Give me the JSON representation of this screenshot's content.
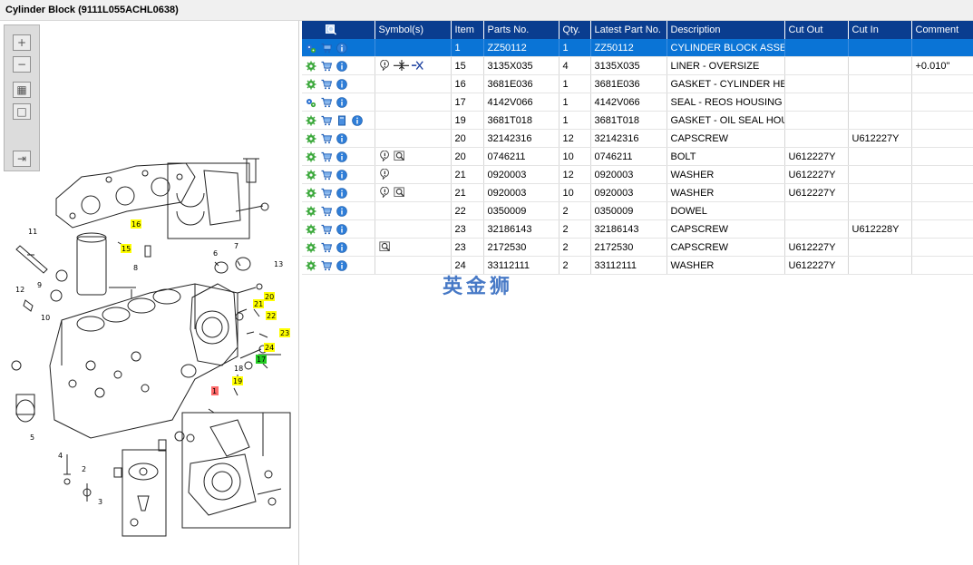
{
  "window": {
    "title": "Cylinder Block (9111L055ACHL0638)"
  },
  "toolbar": {
    "buttons": [
      {
        "icon": "zoom-in-icon"
      },
      {
        "icon": "zoom-out-icon"
      },
      {
        "icon": "fit-view-icon"
      },
      {
        "icon": "actual-size-icon"
      },
      {
        "icon": "export-icon"
      }
    ]
  },
  "diagram": {
    "callouts_plain": [
      "11",
      "8",
      "6",
      "7",
      "13",
      "12",
      "9",
      "10",
      "18",
      "5",
      "4",
      "3",
      "2"
    ],
    "callouts_yellow": [
      "16",
      "15",
      "20",
      "21",
      "22",
      "23",
      "24",
      "19"
    ],
    "callouts_green": [
      "17"
    ],
    "callouts_red": [
      "1"
    ]
  },
  "grid": {
    "headers": {
      "symbols": "Symbol(s)",
      "item": "Item",
      "parts_no": "Parts No.",
      "qty": "Qty.",
      "latest": "Latest Part No.",
      "description": "Description",
      "cut_out": "Cut Out",
      "cut_in": "Cut In",
      "comment": "Comment"
    },
    "rows": [
      {
        "item": "1",
        "parts_no": "ZZ50112",
        "qty": "1",
        "latest": "ZZ50112",
        "description": "CYLINDER BLOCK ASSEMBLY",
        "cut_out": "",
        "cut_in": "",
        "comment": ""
      },
      {
        "item": "15",
        "parts_no": "3135X035",
        "qty": "4",
        "latest": "3135X035",
        "description": "LINER - OVERSIZE",
        "cut_out": "",
        "cut_in": "",
        "comment": "+0.010\""
      },
      {
        "item": "16",
        "parts_no": "3681E036",
        "qty": "1",
        "latest": "3681E036",
        "description": "GASKET - CYLINDER HEAD",
        "cut_out": "",
        "cut_in": "",
        "comment": ""
      },
      {
        "item": "17",
        "parts_no": "4142V066",
        "qty": "1",
        "latest": "4142V066",
        "description": "SEAL - REOS HOUSING",
        "cut_out": "",
        "cut_in": "",
        "comment": ""
      },
      {
        "item": "19",
        "parts_no": "3681T018",
        "qty": "1",
        "latest": "3681T018",
        "description": "GASKET - OIL SEAL HOUSING",
        "cut_out": "",
        "cut_in": "",
        "comment": ""
      },
      {
        "item": "20",
        "parts_no": "32142316",
        "qty": "12",
        "latest": "32142316",
        "description": "CAPSCREW",
        "cut_out": "",
        "cut_in": "U612227Y",
        "comment": ""
      },
      {
        "item": "20",
        "parts_no": "0746211",
        "qty": "10",
        "latest": "0746211",
        "description": "BOLT",
        "cut_out": "U612227Y",
        "cut_in": "",
        "comment": ""
      },
      {
        "item": "21",
        "parts_no": "0920003",
        "qty": "12",
        "latest": "0920003",
        "description": "WASHER",
        "cut_out": "U612227Y",
        "cut_in": "",
        "comment": ""
      },
      {
        "item": "21",
        "parts_no": "0920003",
        "qty": "10",
        "latest": "0920003",
        "description": "WASHER",
        "cut_out": "U612227Y",
        "cut_in": "",
        "comment": ""
      },
      {
        "item": "22",
        "parts_no": "0350009",
        "qty": "2",
        "latest": "0350009",
        "description": "DOWEL",
        "cut_out": "",
        "cut_in": "",
        "comment": ""
      },
      {
        "item": "23",
        "parts_no": "32186143",
        "qty": "2",
        "latest": "32186143",
        "description": "CAPSCREW",
        "cut_out": "",
        "cut_in": "U612228Y",
        "comment": ""
      },
      {
        "item": "23",
        "parts_no": "2172530",
        "qty": "2",
        "latest": "2172530",
        "description": "CAPSCREW",
        "cut_out": "U612227Y",
        "cut_in": "",
        "comment": ""
      },
      {
        "item": "24",
        "parts_no": "33112111",
        "qty": "2",
        "latest": "33112111",
        "description": "WASHER",
        "cut_out": "U612227Y",
        "cut_in": "",
        "comment": ""
      }
    ]
  },
  "watermark": "英金狮",
  "colors": {
    "header": "#0a3d8f",
    "selected": "#0a74d6",
    "callout_yellow": "#ffff00",
    "callout_green": "#22cc22",
    "callout_red": "#ff6b6b"
  }
}
